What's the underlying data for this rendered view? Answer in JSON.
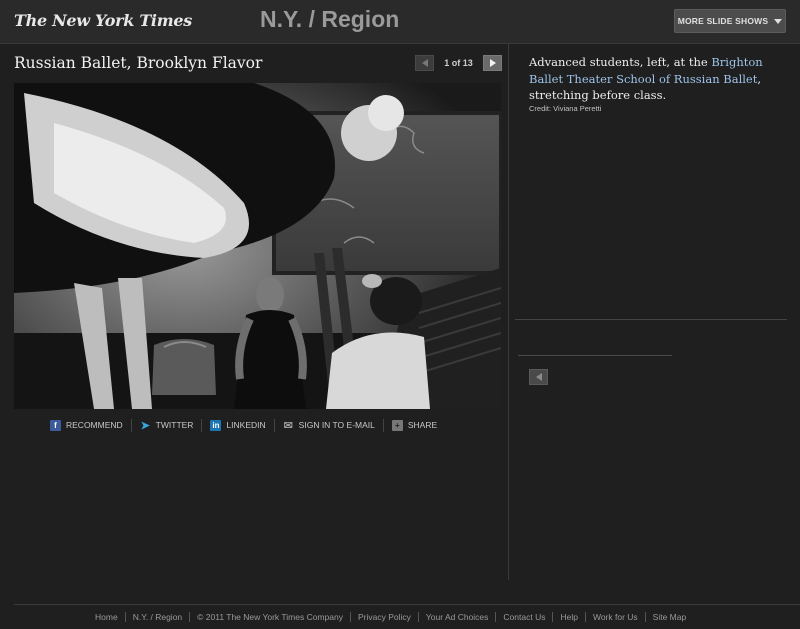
{
  "header": {
    "logo": "The New York Times",
    "section": "N.Y. / Region",
    "more_button": "MORE SLIDE SHOWS"
  },
  "slideshow": {
    "title": "Russian Ballet, Brooklyn Flavor",
    "counter": "1 of 13",
    "photo_alt": "Advanced students stretching before ballet class"
  },
  "caption": {
    "text_before": "Advanced students, left, at the ",
    "link": "Brighton Ballet Theater School of Russian Ballet",
    "text_after": ", stretching before class.",
    "credit": "Credit: Viviana Peretti"
  },
  "share": {
    "recommend": "RECOMMEND",
    "twitter": "TWITTER",
    "linkedin": "LINKEDIN",
    "email": "SIGN IN TO E-MAIL",
    "share": "SHARE"
  },
  "footer": {
    "items": [
      "Home",
      "N.Y. / Region",
      "© 2011 The New York Times Company",
      "Privacy Policy",
      "Your Ad Choices",
      "Contact Us",
      "Help",
      "Work for Us",
      "Site Map"
    ]
  },
  "icons": {
    "prev": "arrow-left-icon",
    "next": "arrow-right-icon",
    "facebook": "facebook-icon",
    "twitter": "twitter-icon",
    "linkedin": "linkedin-icon",
    "email": "email-icon",
    "share": "share-icon",
    "dropdown": "chevron-down-icon"
  },
  "colors": {
    "background": "#1f1f1f",
    "link": "#9ec2e8",
    "facebook": "#3b5b9d",
    "linkedin": "#1a75b3",
    "twitter": "#36a8df"
  }
}
